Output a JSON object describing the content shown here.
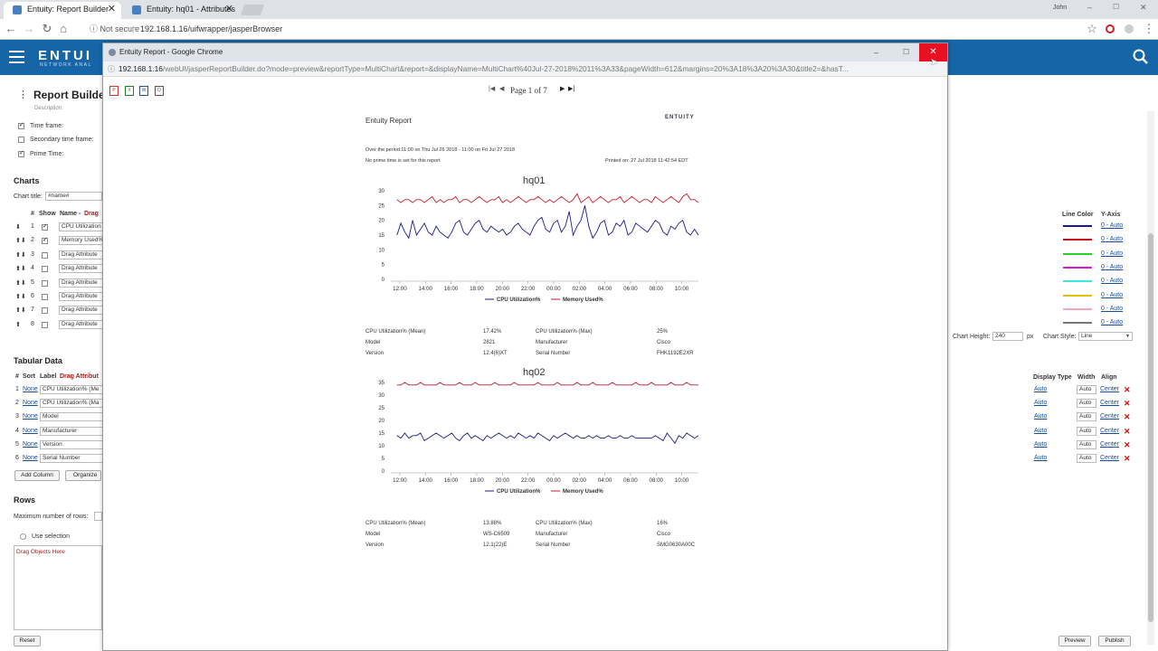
{
  "browser": {
    "tabs": [
      {
        "label": "Entuity: Report Builder",
        "active": true
      },
      {
        "label": "Entuity: hq01 - Attributes",
        "active": false
      }
    ],
    "user": "John",
    "not_secure": "Not secure",
    "url": "192.168.1.16/uifwrapper/jasperBrowser"
  },
  "app": {
    "logo": "ENTUI",
    "logo_sub": "NETWORK ANAL",
    "page_title": "Report Builder",
    "description_label": "Description:",
    "options": [
      {
        "label": "Time frame:",
        "checked": true
      },
      {
        "label": "Secondary time frame:",
        "checked": false
      },
      {
        "label": "Prime Time:",
        "checked": true
      }
    ],
    "charts_heading": "Charts",
    "chart_title_label": "Chart title:",
    "chart_title_value": "#name#",
    "chart_cols": {
      "num": "#",
      "show": "Show",
      "name": "Name -",
      "drag": "Drag"
    },
    "chart_rows": [
      {
        "n": "1",
        "checked": true,
        "value": "CPU Utilization"
      },
      {
        "n": "2",
        "checked": true,
        "value": "Memory Used%"
      },
      {
        "n": "3",
        "checked": false,
        "value": "Drag Attribute"
      },
      {
        "n": "4",
        "checked": false,
        "value": "Drag Attribute"
      },
      {
        "n": "5",
        "checked": false,
        "value": "Drag Attribute"
      },
      {
        "n": "6",
        "checked": false,
        "value": "Drag Attribute"
      },
      {
        "n": "7",
        "checked": false,
        "value": "Drag Attribute"
      },
      {
        "n": "8",
        "checked": false,
        "value": "Drag Attribute"
      }
    ],
    "tabular_heading": "Tabular Data",
    "tab_cols": {
      "num": "#",
      "sort": "Sort",
      "label": "Label",
      "drag": "Drag Attribut"
    },
    "tab_rows": [
      {
        "n": "1",
        "sort": "None",
        "label": "CPU Utilization% (Me"
      },
      {
        "n": "2",
        "sort": "None",
        "label": "CPU Utilization% (Ma"
      },
      {
        "n": "3",
        "sort": "None",
        "label": "Model"
      },
      {
        "n": "4",
        "sort": "None",
        "label": "Manufacturer"
      },
      {
        "n": "5",
        "sort": "None",
        "label": "Version"
      },
      {
        "n": "6",
        "sort": "None",
        "label": "Serial Number"
      }
    ],
    "add_column": "Add Column",
    "organize": "Organize",
    "rows_heading": "Rows",
    "max_rows_label": "Maximum number of rows:",
    "use_selection": "Use selection",
    "drag_objects": "Drag Objects Here",
    "reset": "Reset",
    "preview": "Preview",
    "publish": "Publish",
    "right": {
      "line_color": "Line Color",
      "y_axis": "Y-Axis",
      "lines": [
        {
          "color": "#1a1a8c",
          "axis": "0 - Auto"
        },
        {
          "color": "#d01010",
          "axis": "0 - Auto"
        },
        {
          "color": "#2bd12b",
          "axis": "0 - Auto"
        },
        {
          "color": "#d21ed2",
          "axis": "0 - Auto"
        },
        {
          "color": "#3ee6e6",
          "axis": "0 - Auto"
        },
        {
          "color": "#e6c000",
          "axis": "0 - Auto"
        },
        {
          "color": "#f0a8b8",
          "axis": "0 - Auto"
        },
        {
          "color": "#777777",
          "axis": "0 - Auto"
        }
      ],
      "chart_height_label": "Chart Height:",
      "chart_height_value": "240",
      "px": "px",
      "chart_style_label": "Chart Style:",
      "chart_style_value": "Line",
      "display_type": "Display Type",
      "width": "Width",
      "align": "Align",
      "display_rows": [
        {
          "type": "Auto",
          "width": "Auto",
          "align": "Center"
        },
        {
          "type": "Auto",
          "width": "Auto",
          "align": "Center"
        },
        {
          "type": "Auto",
          "width": "Auto",
          "align": "Center"
        },
        {
          "type": "Auto",
          "width": "Auto",
          "align": "Center"
        },
        {
          "type": "Auto",
          "width": "Auto",
          "align": "Center"
        },
        {
          "type": "Auto",
          "width": "Auto",
          "align": "Center"
        }
      ]
    }
  },
  "popup": {
    "title": "Entuity Report - Google Chrome",
    "url_host": "192.168.1.16",
    "url_path": "/webUI/jasperReportBuilder.do?mode=preview&reportType=MultiChart&report=&displayName=MultiChart%40Jul-27-2018%2011%3A33&pageWidth=612&margins=20%3A18%3A20%3A30&title2=&hasT...",
    "page_label": "Page 1 of 7",
    "report": {
      "title": "Entuity Report",
      "brand": "ENTUITY",
      "period": "Over the period 11:00 on Thu Jul 26 2018 - 11:00 on Fri Jul 27 2018",
      "prime": "No prime time is set for this report",
      "printed": "Printed on: 27 Jul 2018 11:42:54 EDT",
      "legend_cpu": "CPU Utilization%",
      "legend_mem": "Memory Used%",
      "devices": [
        {
          "name": "hq01",
          "stats": [
            [
              "CPU Utilization% (Mean)",
              "17.42%",
              "CPU Utilization% (Max)",
              "25%"
            ],
            [
              "Model",
              "2821",
              "Manufacturer",
              "Cisco"
            ],
            [
              "Version",
              "12.4(6)XT",
              "Serial Number",
              "FHK1192E2XR"
            ]
          ]
        },
        {
          "name": "hq02",
          "stats": [
            [
              "CPU Utilization% (Mean)",
              "13.88%",
              "CPU Utilization% (Max)",
              "16%"
            ],
            [
              "Model",
              "WS-C6509",
              "Manufacturer",
              "Cisco"
            ],
            [
              "Version",
              "12.1(22)E",
              "Serial Number",
              "SMG0630A00C"
            ]
          ]
        }
      ]
    }
  },
  "chart_data": [
    {
      "type": "line",
      "title": "hq01",
      "x": [
        "12:00",
        "14:00",
        "16:00",
        "18:00",
        "20:00",
        "22:00",
        "00:00",
        "02:00",
        "04:00",
        "06:00",
        "08:00",
        "10:00"
      ],
      "ylim": [
        0,
        30
      ],
      "yticks": [
        0,
        5,
        10,
        15,
        20,
        25,
        30
      ],
      "series": [
        {
          "name": "CPU Utilization%",
          "color": "#1a1a8c",
          "values": [
            15,
            19,
            16,
            14,
            20,
            15,
            17,
            19,
            16,
            15,
            18,
            16,
            15,
            14,
            16,
            19,
            20,
            16,
            15,
            17,
            19,
            20,
            17,
            16,
            18,
            17,
            16,
            17,
            15,
            16,
            18,
            19,
            17,
            16,
            15,
            18,
            20,
            21,
            17,
            16,
            19,
            20,
            16,
            18,
            23,
            15,
            18,
            20,
            25,
            18,
            14,
            16,
            19,
            20,
            15,
            16,
            19,
            18,
            20,
            15,
            16,
            19,
            18,
            17,
            16,
            18,
            20,
            19,
            16,
            15,
            18,
            17,
            19,
            20,
            16,
            15,
            17,
            15
          ]
        },
        {
          "name": "Memory Used%",
          "color": "#c21a2a",
          "values": [
            27,
            26,
            27,
            27,
            26,
            27,
            27,
            26,
            27,
            28,
            26,
            27,
            26,
            27,
            27,
            28,
            26,
            27,
            27,
            26,
            27,
            28,
            27,
            26,
            27,
            27,
            28,
            26,
            27,
            26,
            27,
            28,
            27,
            26,
            27,
            27,
            28,
            27,
            26,
            27,
            26,
            27,
            28,
            27,
            26,
            27,
            29,
            26,
            27,
            28,
            26,
            27,
            28,
            27,
            26,
            27,
            27,
            28,
            26,
            27,
            28,
            27,
            26,
            27,
            27,
            26,
            28,
            27,
            26,
            27,
            28,
            27,
            26,
            28,
            29,
            27,
            27,
            26
          ]
        }
      ]
    },
    {
      "type": "line",
      "title": "hq02",
      "x": [
        "12:00",
        "14:00",
        "16:00",
        "18:00",
        "20:00",
        "22:00",
        "00:00",
        "02:00",
        "04:00",
        "06:00",
        "08:00",
        "10:00"
      ],
      "ylim": [
        0,
        35
      ],
      "yticks": [
        0,
        5,
        10,
        15,
        20,
        25,
        30,
        35
      ],
      "series": [
        {
          "name": "CPU Utilization%",
          "color": "#1a1a8c",
          "values": [
            14,
            13,
            15,
            13,
            14,
            14,
            15,
            12,
            13,
            14,
            15,
            14,
            13,
            14,
            15,
            13,
            12,
            14,
            15,
            13,
            14,
            13,
            12,
            14,
            13,
            14,
            15,
            14,
            13,
            14,
            13,
            15,
            14,
            13,
            14,
            13,
            15,
            14,
            13,
            12,
            14,
            13,
            14,
            15,
            14,
            13,
            14,
            13,
            13,
            14,
            13,
            14,
            13,
            13,
            14,
            13,
            13,
            14,
            13,
            13,
            14,
            13,
            13,
            13,
            13,
            13,
            14,
            13,
            12,
            15,
            13,
            11,
            14,
            13,
            15,
            14,
            13,
            14
          ]
        },
        {
          "name": "Memory Used%",
          "color": "#c21a2a",
          "values": [
            34,
            34,
            35,
            34,
            34,
            34,
            35,
            34,
            34,
            34,
            34,
            35,
            34,
            34,
            34,
            34,
            35,
            34,
            34,
            34,
            35,
            34,
            34,
            34,
            34,
            35,
            34,
            34,
            34,
            34,
            35,
            34,
            34,
            34,
            34,
            34,
            35,
            34,
            34,
            34,
            34,
            35,
            34,
            34,
            34,
            34,
            35,
            34,
            34,
            34,
            35,
            34,
            34,
            34,
            34,
            35,
            34,
            34,
            34,
            34,
            34,
            35,
            34,
            34,
            34,
            35,
            34,
            34,
            34,
            34,
            35,
            34,
            34,
            34,
            35,
            34,
            34,
            34
          ]
        }
      ]
    }
  ]
}
